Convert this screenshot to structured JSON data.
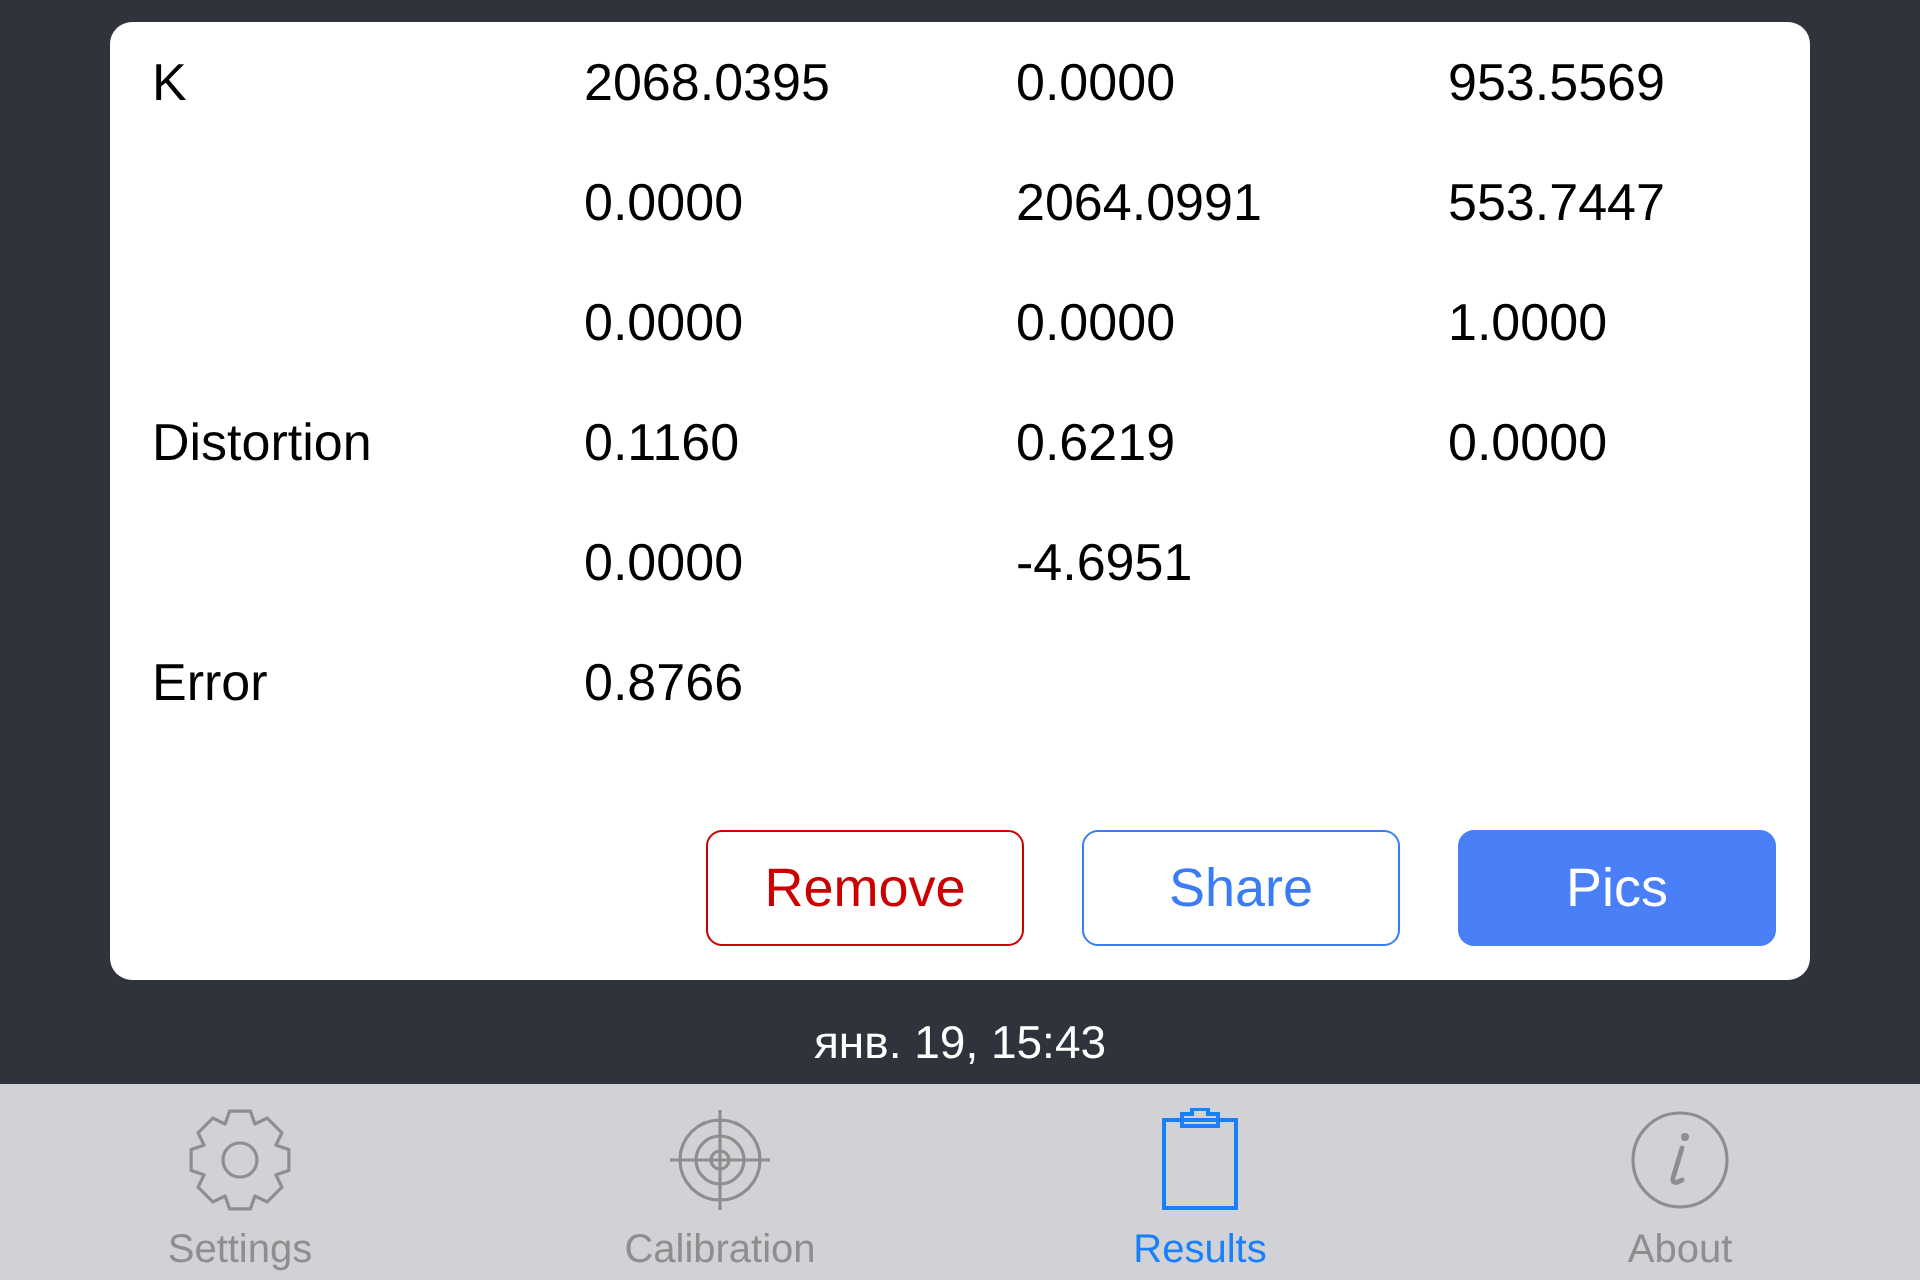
{
  "matrix": {
    "rows": [
      {
        "label": "K",
        "values": [
          "2068.0395",
          "0.0000",
          "953.5569"
        ]
      },
      {
        "values": [
          "0.0000",
          "2064.0991",
          "553.7447"
        ]
      },
      {
        "values": [
          "0.0000",
          "0.0000",
          "1.0000"
        ]
      },
      {
        "label": "Distortion",
        "values": [
          "0.1160",
          "0.6219",
          "0.0000"
        ]
      },
      {
        "values": [
          "0.0000",
          "-4.6951"
        ]
      },
      {
        "label": "Error",
        "values": [
          "0.8766"
        ]
      }
    ]
  },
  "buttons": [
    {
      "label": "Remove",
      "kind": "destructive"
    },
    {
      "label": "Share",
      "kind": "outline"
    },
    {
      "label": "Pics",
      "kind": "filled"
    }
  ],
  "timestamp": "янв. 19, 15:43",
  "tab_bar": {
    "tabs": [
      {
        "label": "Settings",
        "selected": false
      },
      {
        "label": "Calibration",
        "selected": false
      },
      {
        "label": "Results",
        "selected": true
      },
      {
        "label": "About",
        "selected": false
      }
    ]
  }
}
